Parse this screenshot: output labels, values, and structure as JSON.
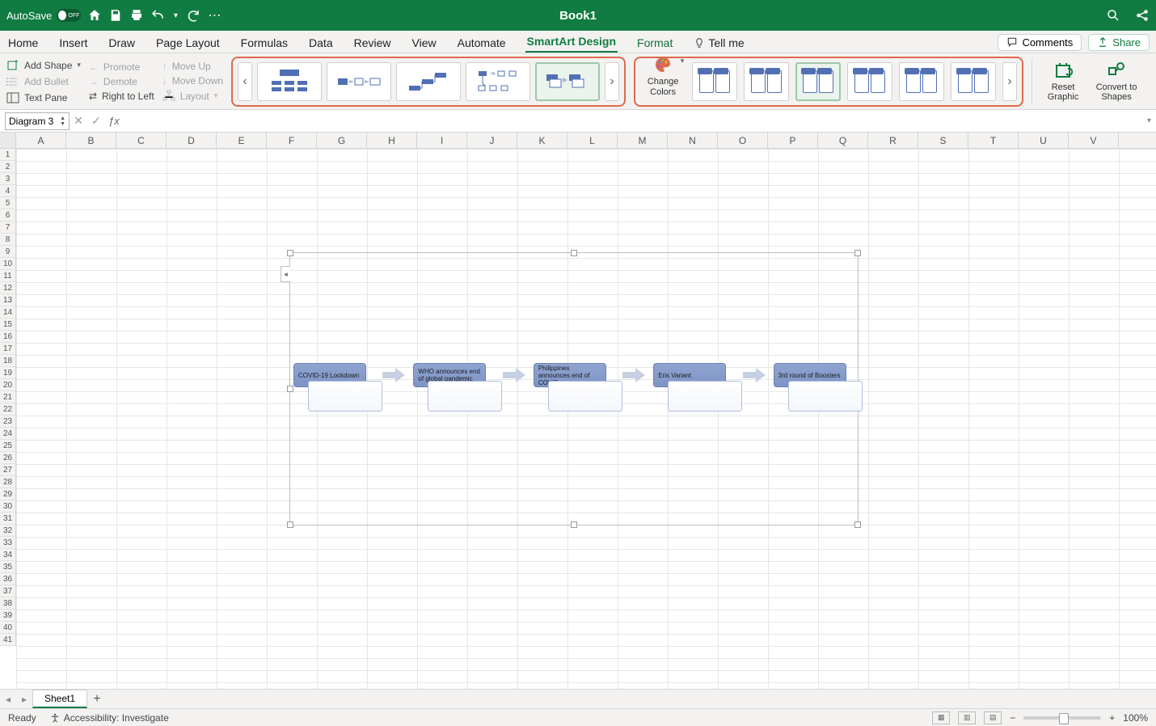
{
  "titlebar": {
    "autosave_label": "AutoSave",
    "autosave_state": "OFF",
    "title": "Book1"
  },
  "tabs": {
    "items": [
      "Home",
      "Insert",
      "Draw",
      "Page Layout",
      "Formulas",
      "Data",
      "Review",
      "View",
      "Automate",
      "SmartArt Design",
      "Format",
      "Tell me"
    ],
    "active_index": 9,
    "comments_label": "Comments",
    "share_label": "Share"
  },
  "ribbon": {
    "add_shape": "Add Shape",
    "add_bullet": "Add Bullet",
    "text_pane": "Text Pane",
    "promote": "Promote",
    "demote": "Demote",
    "rtl": "Right to Left",
    "move_up": "Move Up",
    "move_down": "Move Down",
    "layout": "Layout",
    "change_colors": "Change Colors",
    "reset_graphic": "Reset Graphic",
    "convert": "Convert to Shapes"
  },
  "name_box": {
    "value": "Diagram 3"
  },
  "columns": [
    "A",
    "B",
    "C",
    "D",
    "E",
    "F",
    "G",
    "H",
    "I",
    "J",
    "K",
    "L",
    "M",
    "N",
    "O",
    "P",
    "Q",
    "R",
    "S",
    "T",
    "U",
    "V"
  ],
  "row_count": 41,
  "smartart": {
    "nodes": [
      {
        "title": "COVID-19 Lockdown"
      },
      {
        "title": "WHO announces end of global pandemic"
      },
      {
        "title": "Philippines announces end of COVID"
      },
      {
        "title": "Eris Variant"
      },
      {
        "title": "3rd round of Boosters"
      }
    ]
  },
  "sheets": {
    "active": "Sheet1"
  },
  "status": {
    "ready": "Ready",
    "accessibility": "Accessibility: Investigate",
    "zoom": "100%"
  }
}
